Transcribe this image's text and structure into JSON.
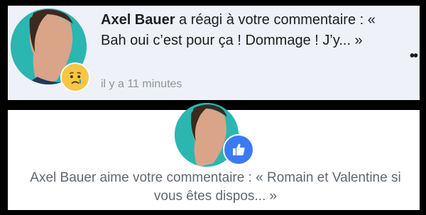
{
  "notification_1": {
    "actor": "Axel Bauer",
    "message": " a réagi à votre commentaire : « Bah oui c’est pour ça ! Dommage ! J’y... »",
    "time": "il y a 11 minutes",
    "reaction_icon": "sad-reaction-icon",
    "more_icon": "more-options-icon"
  },
  "notification_2": {
    "message": "Axel Bauer aime votre commentaire : « Romain et Valentine si vous êtes dispos... »",
    "reaction_icon": "like-reaction-icon"
  },
  "colors": {
    "sad_reaction": "#f7c646",
    "like_reaction": "#3b7af4",
    "avatar_bg": "#2bb6b1",
    "unread_bg": "#eef1f7"
  }
}
